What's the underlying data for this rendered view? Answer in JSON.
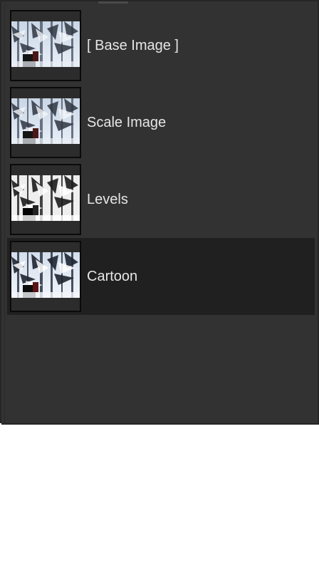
{
  "layers_panel": {
    "items": [
      {
        "label": "[ Base Image ]",
        "thumbnail": "snowy-forest-thumbnail-icon",
        "selected": false,
        "tone": "blue"
      },
      {
        "label": "Scale Image",
        "thumbnail": "snowy-forest-thumbnail-icon",
        "selected": false,
        "tone": "blue"
      },
      {
        "label": "Levels",
        "thumbnail": "snowy-forest-thumbnail-icon",
        "selected": false,
        "tone": "gray"
      },
      {
        "label": "Cartoon",
        "thumbnail": "snowy-forest-thumbnail-icon",
        "selected": true,
        "tone": "blue"
      }
    ]
  },
  "colors": {
    "panel_background": "#323232",
    "selected_row": "#202020",
    "label_text": "#e6e6e6",
    "thumbnail_border": "#0a0a0a"
  }
}
